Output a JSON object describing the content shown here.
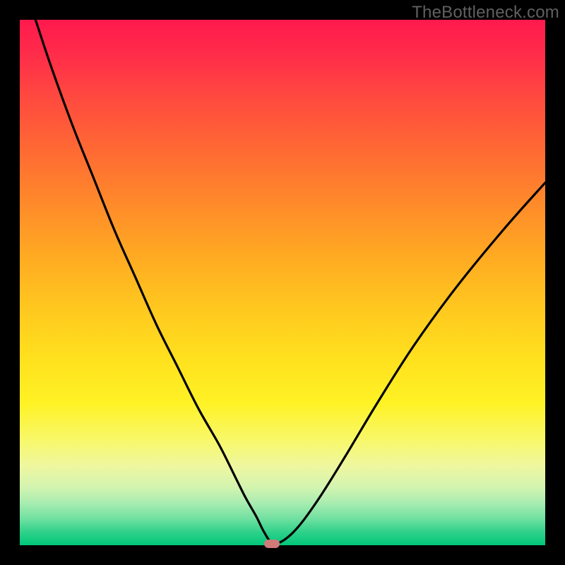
{
  "watermark": "TheBottleneck.com",
  "colors": {
    "frame": "#000000",
    "curve": "#000000",
    "marker": "#cf7b78"
  },
  "chart_data": {
    "type": "line",
    "title": "",
    "xlabel": "",
    "ylabel": "",
    "xlim": [
      0,
      100
    ],
    "ylim": [
      0,
      100
    ],
    "grid": false,
    "legend": false,
    "background": "rainbow-vertical (red 100 → green 0)",
    "series": [
      {
        "name": "bottleneck-curve",
        "x": [
          3,
          6,
          10,
          14,
          18,
          22,
          26,
          30,
          34,
          38,
          41,
          43,
          45,
          46.5,
          48,
          50,
          53,
          57,
          62,
          68,
          75,
          83,
          92,
          100
        ],
        "y": [
          100,
          91,
          80,
          70,
          60,
          51,
          42,
          34,
          26,
          19,
          13,
          9,
          5.5,
          2.5,
          0.5,
          0.8,
          3.5,
          9,
          17,
          27,
          38,
          49,
          60,
          69
        ]
      }
    ],
    "marker": {
      "x": 48,
      "y": 0,
      "shape": "pill"
    }
  }
}
